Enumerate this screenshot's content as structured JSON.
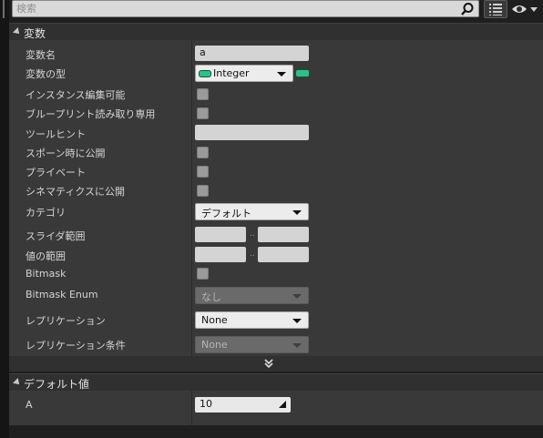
{
  "search": {
    "placeholder": "検索"
  },
  "toolbar": {
    "list_icon": "list-view-icon",
    "eye_icon": "eye-icon"
  },
  "variable_section": {
    "title": "変数",
    "rows": {
      "name": {
        "label": "変数名",
        "value": "a"
      },
      "type": {
        "label": "変数の型",
        "value": "Integer",
        "color": "#2fc08a"
      },
      "instance_editable": {
        "label": "インスタンス編集可能"
      },
      "blueprint_readonly": {
        "label": "ブループリント読み取り専用"
      },
      "tooltip": {
        "label": "ツールヒント",
        "value": ""
      },
      "expose_on_spawn": {
        "label": "スポーン時に公開"
      },
      "private": {
        "label": "プライベート"
      },
      "expose_cinematics": {
        "label": "シネマティクスに公開"
      },
      "category": {
        "label": "カテゴリ",
        "value": "デフォルト"
      },
      "slider_range": {
        "label": "スライダ範囲",
        "separator": ".."
      },
      "value_range": {
        "label": "値の範囲",
        "separator": ".."
      },
      "bitmask": {
        "label": "Bitmask"
      },
      "bitmask_enum": {
        "label": "Bitmask Enum",
        "value": "なし"
      },
      "replication": {
        "label": "レプリケーション",
        "value": "None"
      },
      "replication_condition": {
        "label": "レプリケーション条件",
        "value": "None"
      }
    }
  },
  "default_section": {
    "title": "デフォルト値",
    "rows": {
      "a": {
        "label": "A",
        "value": "10"
      }
    }
  }
}
